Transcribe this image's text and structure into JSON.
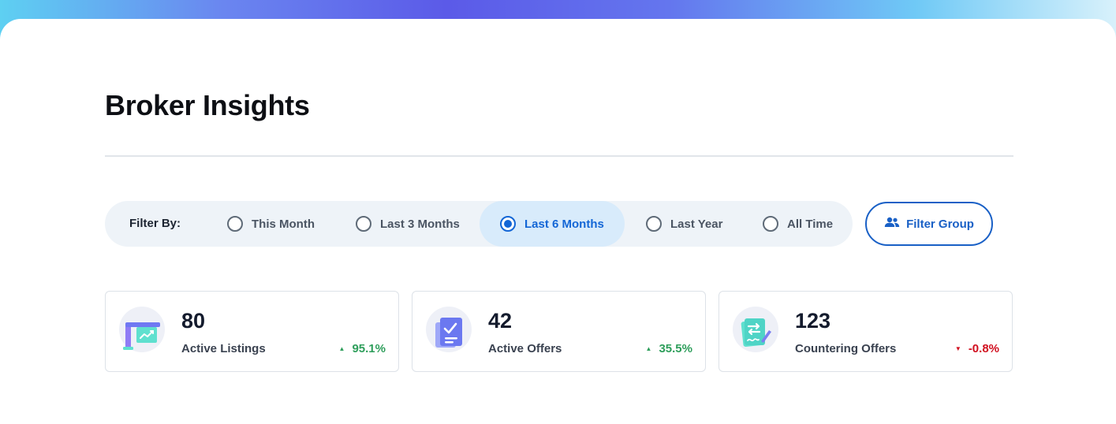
{
  "page": {
    "title": "Broker Insights"
  },
  "filter": {
    "label": "Filter By:",
    "options": [
      {
        "label": "This Month",
        "selected": false
      },
      {
        "label": "Last 3 Months",
        "selected": false
      },
      {
        "label": "Last 6 Months",
        "selected": true
      },
      {
        "label": "Last Year",
        "selected": false
      },
      {
        "label": "All Time",
        "selected": false
      }
    ],
    "group_button": {
      "label": "Filter Group",
      "icon": "people-icon"
    }
  },
  "cards": [
    {
      "value": "80",
      "label": "Active Listings",
      "change": "95.1%",
      "trend": "up",
      "icon": "listing-sign-icon"
    },
    {
      "value": "42",
      "label": "Active Offers",
      "change": "35.5%",
      "trend": "up",
      "icon": "offer-document-icon"
    },
    {
      "value": "123",
      "label": "Countering Offers",
      "change": "-0.8%",
      "trend": "down",
      "icon": "counter-offer-icon"
    }
  ],
  "colors": {
    "accent": "#1366d6",
    "up": "#2e9e5b",
    "down": "#d10f1f",
    "filter_bar_bg": "#eef3f8"
  }
}
